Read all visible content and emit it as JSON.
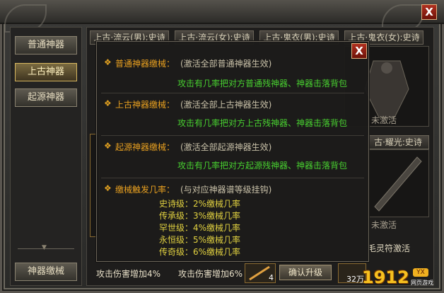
{
  "window": {
    "close_label": "X"
  },
  "sidebar": {
    "tabs": [
      {
        "label": "普通神器",
        "active": false
      },
      {
        "label": "上古神器",
        "active": true
      },
      {
        "label": "起源神器",
        "active": false
      }
    ],
    "bottom_button": "神器缴械"
  },
  "grid": {
    "headers": [
      "上古·流云(男):史诗",
      "上古·流云(女):史诗",
      "上古·鬼衣(男):史诗",
      "上古·鬼衣(女):史诗"
    ],
    "right_header_2": "古·耀光:史诗",
    "status_labels": [
      "未激活",
      "未激活"
    ],
    "increase_left": "攻击伤害增加4%",
    "increase_mid": "攻击伤害增加6%",
    "upgrade_button": "确认升级",
    "item_count_1": "4",
    "item_count_2": "32万",
    "activate_label": "毛灵符激活"
  },
  "overlay": {
    "close_label": "X",
    "sections": [
      {
        "title": "普通神器缴械：",
        "subtitle": "(激活全部普通神器生效)",
        "desc": "攻击有几率把对方普通残神器、神器击落背包"
      },
      {
        "title": "上古神器缴械：",
        "subtitle": "(激活全部上古神器生效)",
        "desc": "攻击有几率把对方上古残神器、神器击落背包"
      },
      {
        "title": "起源神器缴械：",
        "subtitle": "(激活全部起源神器生效)",
        "desc": "攻击有几率把对方起源残神器、神器击落背包"
      }
    ],
    "trigger": {
      "title": "缴械触发几率：",
      "subtitle": "(与对应神器谱等级挂钩)",
      "levels": [
        {
          "text": "史诗级：2%缴械几率"
        },
        {
          "text": "传承级：3%缴械几率"
        },
        {
          "text": "罕世级：4%缴械几率"
        },
        {
          "text": "永恒级：5%缴械几率"
        },
        {
          "text": "传奇级：6%缴械几率"
        }
      ]
    }
  },
  "watermark": {
    "number": "1912",
    "badge": "YX",
    "sub": "网页游戏"
  },
  "colors": {
    "section_title": "#e8a020",
    "desc_green": "#48d030",
    "level_yellow": "#e0d040",
    "close_red": "#b03020"
  }
}
